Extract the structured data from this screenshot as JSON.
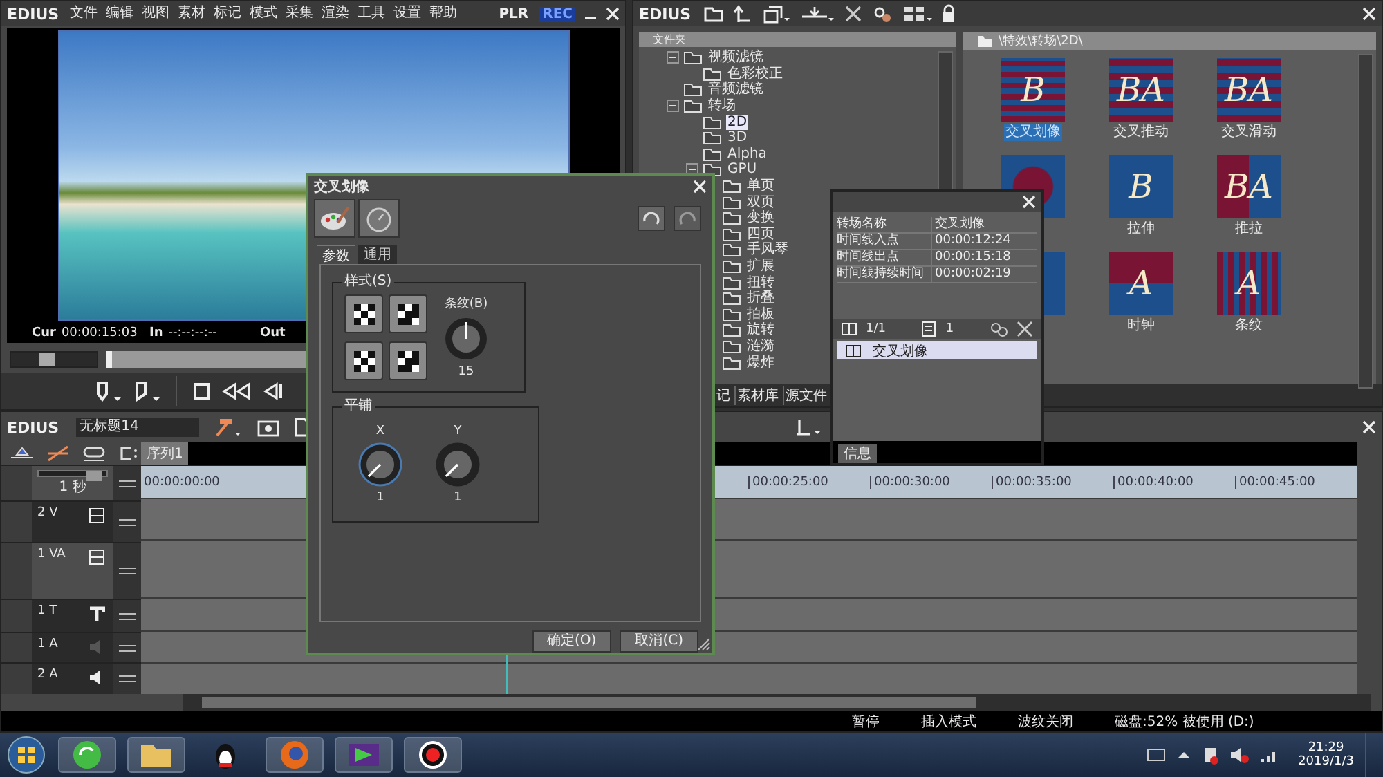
{
  "player": {
    "logo": "EDIUS",
    "menu": [
      "文件",
      "编辑",
      "视图",
      "素材",
      "标记",
      "模式",
      "采集",
      "渲染",
      "工具",
      "设置",
      "帮助"
    ],
    "modes": [
      {
        "label": "PLR",
        "selected": false
      },
      {
        "label": "REC",
        "selected": true
      }
    ],
    "timecodes": [
      {
        "label": "Cur",
        "value": "00:00:15:03"
      },
      {
        "label": "In",
        "value": "--:--:--:--"
      },
      {
        "label": "Out"
      }
    ],
    "shuttle": {
      "level": 0.4
    },
    "position": {
      "level": 0
    }
  },
  "library": {
    "logo": "EDIUS",
    "folder_header": "文件夹",
    "path": "\\特效\\转场\\2D\\",
    "tree": [
      {
        "label": "视频滤镜",
        "selected": false,
        "expanded": true,
        "children": [
          {
            "label": "色彩校正",
            "selected": false
          }
        ]
      },
      {
        "label": "音频滤镜",
        "selected": false
      },
      {
        "label": "转场",
        "selected": false,
        "expanded": true,
        "children": [
          {
            "label": "2D",
            "selected": true
          },
          {
            "label": "3D",
            "selected": false
          },
          {
            "label": "Alpha",
            "selected": false
          },
          {
            "label": "GPU",
            "selected": false,
            "expanded": true,
            "children": [
              {
                "label": "单页",
                "selected": false
              },
              {
                "label": "双页",
                "selected": false
              },
              {
                "label": "变换",
                "selected": false
              },
              {
                "label": "四页",
                "selected": false
              },
              {
                "label": "手风琴",
                "selected": false
              },
              {
                "label": "扩展",
                "selected": false
              },
              {
                "label": "扭转",
                "selected": false
              },
              {
                "label": "折叠",
                "selected": false
              },
              {
                "label": "拍板",
                "selected": false
              },
              {
                "label": "旋转",
                "selected": false
              },
              {
                "label": "涟漪",
                "selected": false
              },
              {
                "label": "爆炸",
                "selected": false
              }
            ]
          }
        ]
      }
    ],
    "effects": [
      {
        "label": "交叉划像",
        "kind": "hstripes",
        "letters": "B",
        "selected": true
      },
      {
        "label": "交叉推动",
        "kind": "checker",
        "letters": "BA",
        "selected": false
      },
      {
        "label": "交叉滑动",
        "kind": "checker",
        "letters": "BA",
        "selected": false
      },
      {
        "kind": "circle"
      },
      {
        "label": "拉伸",
        "kind": "box",
        "letters": "B",
        "selected": false
      },
      {
        "label": "推拉",
        "kind": "split",
        "letters": "BA",
        "selected": false
      },
      {
        "kind": "split"
      },
      {
        "label": "时钟",
        "kind": "halves",
        "letters": "A",
        "selected": false
      },
      {
        "label": "条纹",
        "kind": "vstripes",
        "letters": "A",
        "selected": false
      }
    ],
    "tabs": [
      "记",
      "素材库",
      "源文件"
    ]
  },
  "timeline": {
    "logo": "EDIUS",
    "project": "无标题14",
    "sequence": "序列1",
    "zoom": {
      "level": 0.92
    },
    "scale": "1 秒",
    "ruler": [
      "00:00:00:00",
      "00:00:25:00",
      "00:00:30:00",
      "00:00:35:00",
      "00:00:40:00",
      "00:00:45:00"
    ],
    "tracks": [
      {
        "name": "2 V",
        "kind": "video"
      },
      {
        "name": "1 VA",
        "kind": "va"
      },
      {
        "name": "1 T",
        "kind": "title"
      },
      {
        "name": "1 A",
        "kind": "audio",
        "muted": true
      },
      {
        "name": "2 A",
        "kind": "audio",
        "muted": false
      }
    ]
  },
  "status_bar": [
    "暂停",
    "插入模式",
    "波纹关闭",
    "磁盘:52% 被使用 (D:)"
  ],
  "info": {
    "rows": [
      {
        "name": "转场名称",
        "value": "交叉划像"
      },
      {
        "name": "时间线入点",
        "value": "00:00:12:24"
      },
      {
        "name": "时间线出点",
        "value": "00:00:15:18"
      },
      {
        "name": "时间线持续时间",
        "value": "00:00:02:19"
      }
    ],
    "page": "1/1",
    "count": "1",
    "items": [
      {
        "label": "交叉划像",
        "selected": true
      }
    ],
    "tab": "信息"
  },
  "dialog": {
    "title": "交叉划像",
    "tabs": [
      {
        "label": "参数",
        "selected": true
      },
      {
        "label": "通用",
        "selected": false
      }
    ],
    "style_group": "样式(S)",
    "patterns": [
      {
        "kind": "rows"
      },
      {
        "kind": "cols"
      },
      {
        "kind": "rows"
      },
      {
        "kind": "cols"
      }
    ],
    "stripes": {
      "label": "条纹(B)",
      "value": "15"
    },
    "tile_group": "平铺",
    "tiles": [
      {
        "label": "X",
        "value": "1",
        "focused": true
      },
      {
        "label": "Y",
        "value": "1",
        "focused": false
      }
    ],
    "buttons": [
      "确定(O)",
      "取消(C)"
    ]
  },
  "taskbar": {
    "time": "21:29",
    "date": "2019/1/3"
  }
}
